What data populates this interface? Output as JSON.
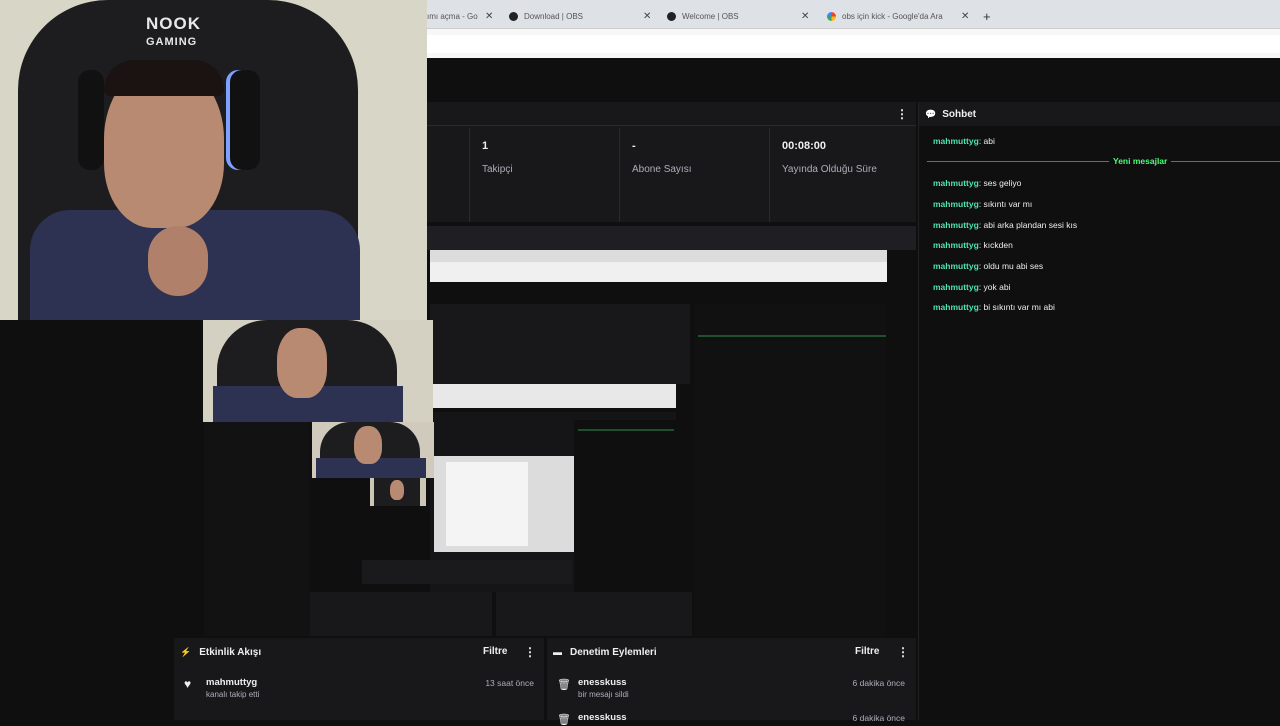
{
  "browser": {
    "tabs": [
      {
        "title": "ımı açma - Go"
      },
      {
        "title": "Download | OBS"
      },
      {
        "title": "Welcome | OBS"
      },
      {
        "title": "obs için kick - Google'da Ara"
      }
    ],
    "new_tab": "+"
  },
  "stats": {
    "items": [
      {
        "value": "1",
        "label": "Takipçi"
      },
      {
        "value": "-",
        "label": "Abone Sayısı"
      },
      {
        "value": "00:08:00",
        "label": "Yayında Olduğu Süre"
      }
    ]
  },
  "chat": {
    "title": "Sohbet",
    "divider_label": "Yeni mesajlar",
    "messages": [
      {
        "user": "mahmuttyg",
        "text": "abi"
      },
      {
        "user": "mahmuttyg",
        "text": "ses geliyo"
      },
      {
        "user": "mahmuttyg",
        "text": "sıkıntı var mı"
      },
      {
        "user": "mahmuttyg",
        "text": "abi arka plandan sesi kıs"
      },
      {
        "user": "mahmuttyg",
        "text": "kıckden"
      },
      {
        "user": "mahmuttyg",
        "text": "oldu mu abi ses"
      },
      {
        "user": "mahmuttyg",
        "text": "yok abi"
      },
      {
        "user": "mahmuttyg",
        "text": "bi sıkıntı var mı abi"
      }
    ]
  },
  "activity": {
    "title": "Etkinlik Akışı",
    "filter": "Filtre",
    "events": [
      {
        "name": "mahmuttyg",
        "desc": "kanalı takip etti",
        "time": "13 saat önce",
        "icon": "heart-icon"
      }
    ]
  },
  "moderation": {
    "title": "Denetim Eylemleri",
    "filter": "Filtre",
    "events": [
      {
        "name": "enesskuss",
        "desc": "bir mesajı sildi",
        "time": "6 dakika önce",
        "icon": "trash-icon"
      },
      {
        "name": "enesskuss",
        "desc": "",
        "time": "6 dakika önce",
        "icon": "trash-icon"
      }
    ]
  },
  "webcam": {
    "chair_brand": "NOOK GAMING"
  },
  "colors": {
    "chat_user": "#4fe3b0",
    "new_messages": "#4dff7a",
    "panel": "#18181b",
    "background": "#0f0f10"
  }
}
